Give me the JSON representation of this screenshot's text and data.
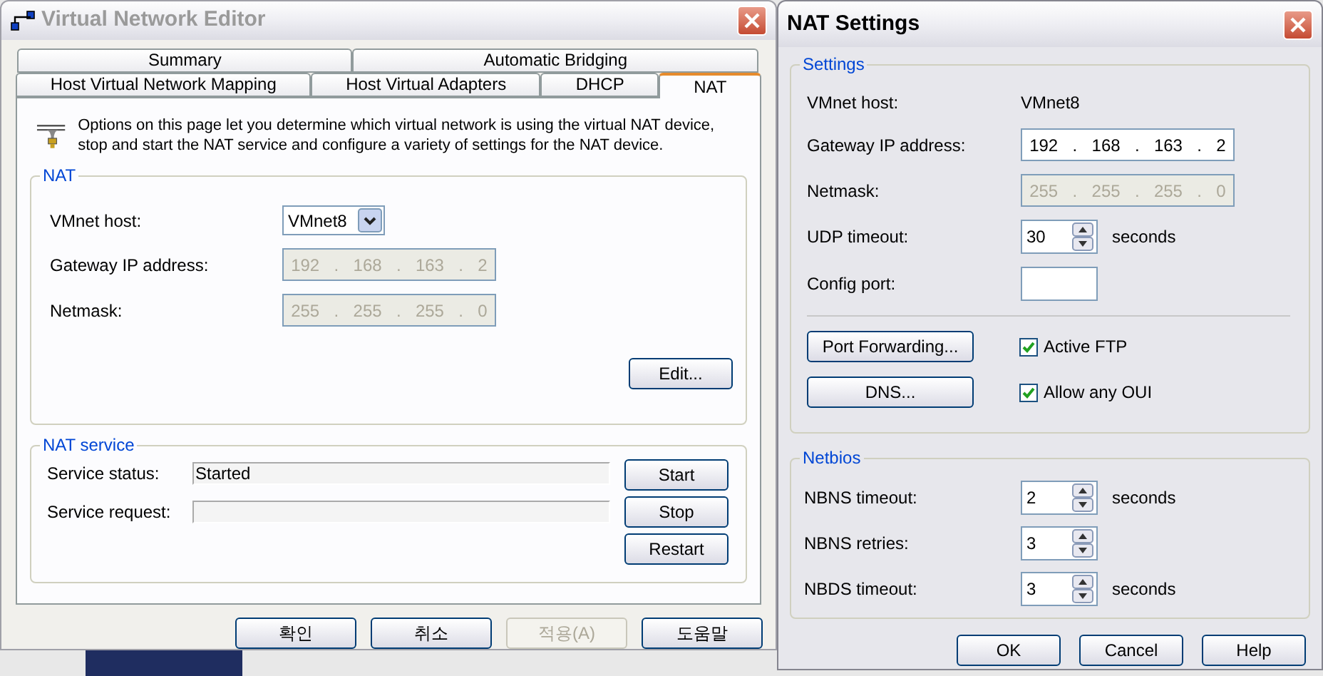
{
  "editor": {
    "title": "Virtual Network Editor",
    "active": false,
    "tab_rows": [
      [
        {
          "label": "Summary",
          "selected": false
        },
        {
          "label": "Automatic Bridging",
          "selected": false
        }
      ],
      [
        {
          "label": "Host Virtual Network Mapping",
          "selected": false
        },
        {
          "label": "Host Virtual Adapters",
          "selected": false
        },
        {
          "label": "DHCP",
          "selected": false
        },
        {
          "label": "NAT",
          "selected": true
        }
      ]
    ],
    "description": "Options on this page let you determine which virtual network is using the virtual NAT device, stop and start the NAT service and configure a variety of settings for the NAT device.",
    "nat_group": {
      "title": "NAT",
      "fields": [
        {
          "label": "VMnet host:",
          "kind": "dropdown",
          "value": "VMnet8"
        },
        {
          "label": "Gateway IP address:",
          "kind": "ip",
          "octets": [
            "192",
            "168",
            "163",
            "2"
          ],
          "separator": ".",
          "disabled": true
        },
        {
          "label": "Netmask:",
          "kind": "ip",
          "octets": [
            "255",
            "255",
            "255",
            "0"
          ],
          "separator": ".",
          "disabled": true
        }
      ],
      "edit_button": "Edit..."
    },
    "service_group": {
      "title": "NAT service",
      "rows": [
        {
          "label": "Service status:",
          "value": "Started"
        },
        {
          "label": "Service request:"
        }
      ],
      "buttons": [
        "Start",
        "Stop",
        "Restart"
      ]
    },
    "buttons": [
      {
        "label": "확인",
        "disabled": false
      },
      {
        "label": "취소",
        "disabled": false
      },
      {
        "label": "적용(A)",
        "disabled": true
      },
      {
        "label": "도움말",
        "disabled": false
      }
    ]
  },
  "nat_settings": {
    "title": "NAT Settings",
    "active": true,
    "settings_group": {
      "title": "Settings",
      "fields": [
        {
          "label": "VMnet host:",
          "kind": "text",
          "value": "VMnet8"
        },
        {
          "label": "Gateway IP address:",
          "kind": "ip",
          "octets": [
            "192",
            "168",
            "163",
            "2"
          ],
          "separator": ".",
          "disabled": false
        },
        {
          "label": "Netmask:",
          "kind": "ip",
          "octets": [
            "255",
            "255",
            "255",
            "0"
          ],
          "separator": ".",
          "disabled": true
        },
        {
          "label": "UDP timeout:",
          "kind": "spin",
          "value": "30",
          "unit": "seconds"
        },
        {
          "label": "Config port:",
          "kind": "input"
        }
      ],
      "buttons": [
        "Port Forwarding...",
        "DNS..."
      ],
      "checkboxes": [
        {
          "label": "Active FTP",
          "checked": true
        },
        {
          "label": "Allow any OUI",
          "checked": true
        }
      ]
    },
    "netbios_group": {
      "title": "Netbios",
      "fields": [
        {
          "label": "NBNS timeout:",
          "kind": "spin",
          "value": "2",
          "unit": "seconds"
        },
        {
          "label": "NBNS retries:",
          "kind": "spin",
          "value": "3"
        },
        {
          "label": "NBDS timeout:",
          "kind": "spin",
          "value": "3",
          "unit": "seconds"
        }
      ]
    },
    "buttons": [
      "OK",
      "Cancel",
      "Help"
    ]
  }
}
